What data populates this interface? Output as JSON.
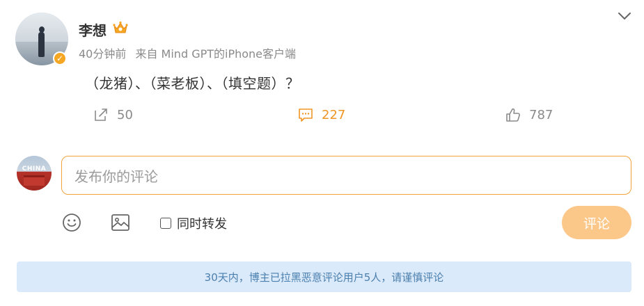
{
  "post": {
    "author": "李想",
    "time": "40分钟前",
    "source": "来自 Mind GPT的iPhone客户端",
    "text": "（龙猪）、（菜老板）、（填空题）？",
    "actions": {
      "repost_count": "50",
      "comment_count": "227",
      "like_count": "787"
    }
  },
  "icons": {
    "verified": "verified-badge-icon",
    "crown": "crown-icon",
    "menu": "chevron-down-icon",
    "repost": "repost-icon",
    "comment": "comment-icon",
    "like": "thumbs-up-icon",
    "emoji": "emoji-icon",
    "image": "image-icon"
  },
  "composer": {
    "avatar_label": "CHINA",
    "placeholder": "发布你的评论",
    "repost_label": "同时转发",
    "submit_label": "评论"
  },
  "notice": "30天内，博主已拉黑恶意评论用户5人，请谨慎评论",
  "colors": {
    "accent": "#f09524",
    "input_border": "#f2a33a",
    "submit_bg": "#fcc88a",
    "notice_bg": "#dbeafa",
    "notice_text": "#4a7fae"
  }
}
